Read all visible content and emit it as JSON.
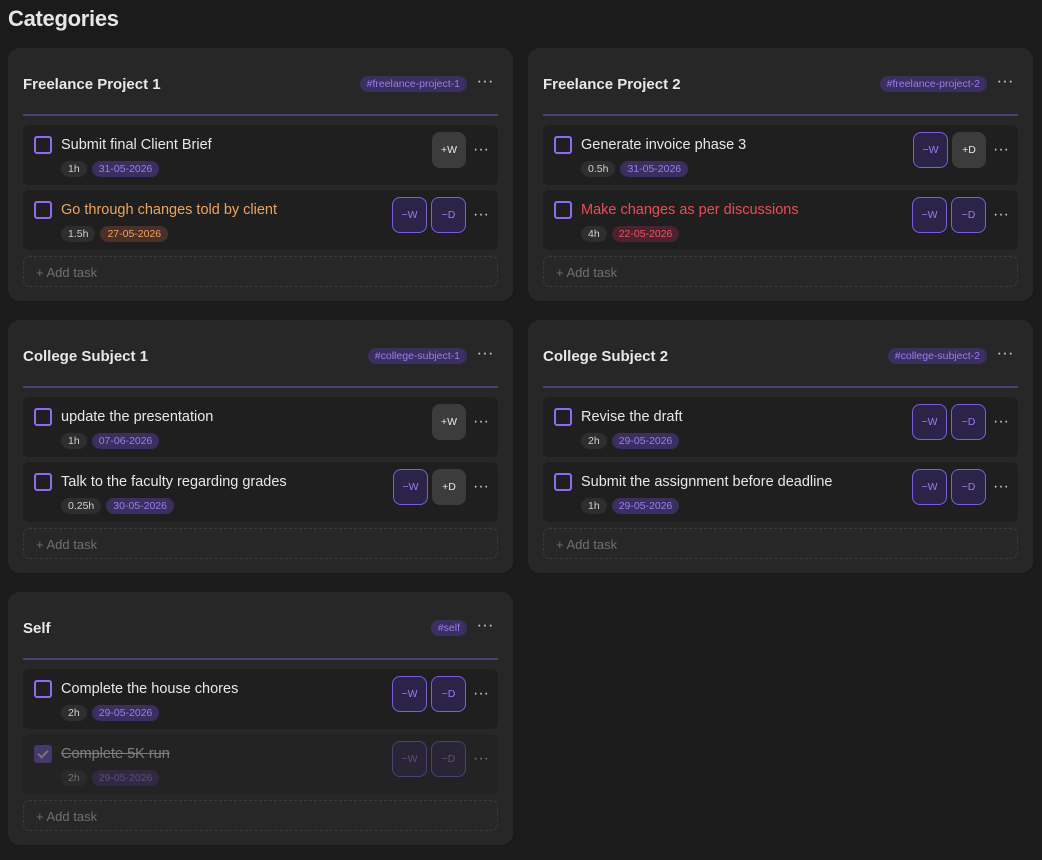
{
  "page": {
    "title": "Categories"
  },
  "colors": {
    "accent": "#8e6cf0",
    "date_default_text": "#9b7cf0",
    "date_default_bg": "#3a2f5e",
    "date_orange_text": "#f0a35a",
    "date_orange_bg": "#4a3028",
    "date_red_text": "#f05060",
    "date_red_bg": "#4a2230",
    "title_orange": "#f0a35a",
    "title_red": "#f04a55"
  },
  "categories": [
    {
      "title": "Freelance Project 1",
      "tag": "#freelance-project-1",
      "menu": "···",
      "add_label": "+  Add task",
      "tasks": [
        {
          "title": "Submit final Client Brief",
          "duration": "1h",
          "date": "31-05-2026",
          "status": "normal",
          "done": false,
          "buttons": [
            {
              "label": "+W",
              "kind": "plus"
            }
          ]
        },
        {
          "title": "Go through changes told by client",
          "duration": "1.5h",
          "date": "27-05-2026",
          "status": "orange",
          "done": false,
          "buttons": [
            {
              "label": "−W",
              "kind": "minus"
            },
            {
              "label": "−D",
              "kind": "minus"
            }
          ]
        }
      ]
    },
    {
      "title": "Freelance Project 2",
      "tag": "#freelance-project-2",
      "menu": "···",
      "add_label": "+  Add task",
      "tasks": [
        {
          "title": "Generate invoice phase 3",
          "duration": "0.5h",
          "date": "31-05-2026",
          "status": "normal",
          "done": false,
          "buttons": [
            {
              "label": "−W",
              "kind": "minus"
            },
            {
              "label": "+D",
              "kind": "plus"
            }
          ]
        },
        {
          "title": "Make changes as per discussions",
          "duration": "4h",
          "date": "22-05-2026",
          "status": "red",
          "done": false,
          "buttons": [
            {
              "label": "−W",
              "kind": "minus"
            },
            {
              "label": "−D",
              "kind": "minus"
            }
          ]
        }
      ]
    },
    {
      "title": "College Subject 1",
      "tag": "#college-subject-1",
      "menu": "···",
      "add_label": "+  Add task",
      "tasks": [
        {
          "title": "update the presentation",
          "duration": "1h",
          "date": "07-06-2026",
          "status": "normal",
          "done": false,
          "buttons": [
            {
              "label": "+W",
              "kind": "plus"
            }
          ]
        },
        {
          "title": "Talk to the faculty regarding grades",
          "duration": "0.25h",
          "date": "30-05-2026",
          "status": "normal",
          "done": false,
          "buttons": [
            {
              "label": "−W",
              "kind": "minus"
            },
            {
              "label": "+D",
              "kind": "plus"
            }
          ]
        }
      ]
    },
    {
      "title": "College Subject 2",
      "tag": "#college-subject-2",
      "menu": "···",
      "add_label": "+  Add task",
      "tasks": [
        {
          "title": "Revise the draft",
          "duration": "2h",
          "date": "29-05-2026",
          "status": "normal",
          "done": false,
          "buttons": [
            {
              "label": "−W",
              "kind": "minus"
            },
            {
              "label": "−D",
              "kind": "minus"
            }
          ]
        },
        {
          "title": "Submit the assignment before deadline",
          "duration": "1h",
          "date": "29-05-2026",
          "status": "normal",
          "done": false,
          "buttons": [
            {
              "label": "−W",
              "kind": "minus"
            },
            {
              "label": "−D",
              "kind": "minus"
            }
          ]
        }
      ]
    },
    {
      "title": "Self",
      "tag": "#self",
      "menu": "···",
      "add_label": "+  Add task",
      "tasks": [
        {
          "title": "Complete the house chores",
          "duration": "2h",
          "date": "29-05-2026",
          "status": "normal",
          "done": false,
          "buttons": [
            {
              "label": "−W",
              "kind": "minus"
            },
            {
              "label": "−D",
              "kind": "minus"
            }
          ]
        },
        {
          "title": "Complete 5K run",
          "duration": "2h",
          "date": "29-05-2026",
          "status": "normal",
          "done": true,
          "buttons": [
            {
              "label": "−W",
              "kind": "minus"
            },
            {
              "label": "−D",
              "kind": "minus"
            }
          ]
        }
      ]
    }
  ],
  "task_menu": "···"
}
